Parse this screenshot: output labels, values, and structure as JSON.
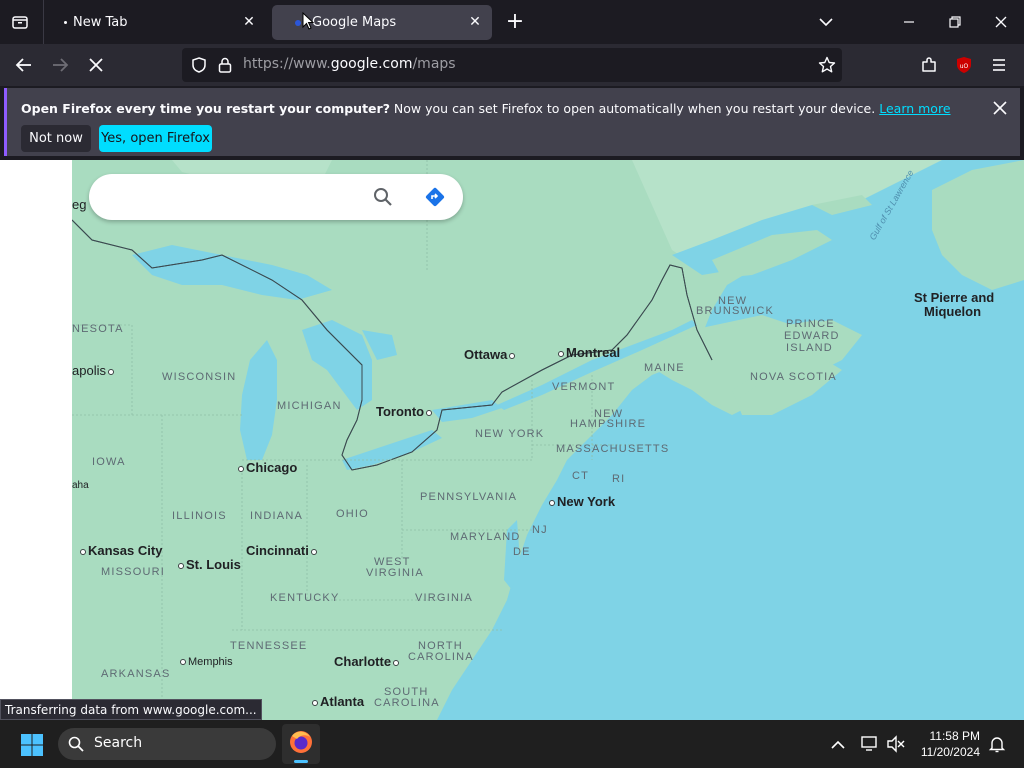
{
  "browser": {
    "tabs": [
      {
        "label": "New Tab",
        "active": false
      },
      {
        "label": "Google Maps",
        "active": true
      }
    ],
    "url": {
      "prefix": "https://www.",
      "domain": "google.com",
      "path": "/maps"
    },
    "status_text": "Transferring data from www.google.com..."
  },
  "notification": {
    "title": "Open Firefox every time you restart your computer?",
    "message": " Now you can set Firefox to open automatically when you restart your device.",
    "link": "Learn more",
    "not_now": "Not now",
    "yes": "Yes, open Firefox"
  },
  "map": {
    "labels": {
      "gulf": "Gulf of St Lawrence",
      "st_pierre_1": "St Pierre and",
      "st_pierre_2": "Miquelon",
      "new_brunswick_1": "NEW",
      "new_brunswick_2": "BRUNSWICK",
      "pei_1": "PRINCE",
      "pei_2": "EDWARD",
      "pei_3": "ISLAND",
      "nova_scotia": "NOVA SCOTIA",
      "maine": "MAINE",
      "vermont": "VERMONT",
      "nh_1": "NEW",
      "nh_2": "HAMPSHIRE",
      "massachusetts": "MASSACHUSETTS",
      "ct": "CT",
      "ri": "RI",
      "new_york_state": "NEW YORK",
      "new_york_city": "New York",
      "nj": "NJ",
      "de": "DE",
      "maryland": "MARYLAND",
      "pennsylvania": "PENNSYLVANIA",
      "ottawa": "Ottawa",
      "montreal": "Montreal",
      "toronto": "Toronto",
      "michigan": "MICHIGAN",
      "wisconsin": "WISCONSIN",
      "minnesota": "NESOTA",
      "minneapolis": "apolis",
      "iowa": "IOWA",
      "omaha": "aha",
      "chicago": "Chicago",
      "illinois": "ILLINOIS",
      "indiana": "INDIANA",
      "ohio": "OHIO",
      "kansas_city": "Kansas City",
      "missouri": "MISSOURI",
      "st_louis": "St. Louis",
      "cincinnati": "Cincinnati",
      "west_virginia_1": "WEST",
      "west_virginia_2": "VIRGINIA",
      "virginia": "VIRGINIA",
      "kentucky": "KENTUCKY",
      "tennessee": "TENNESSEE",
      "memphis": "Memphis",
      "arkansas": "ARKANSAS",
      "charlotte": "Charlotte",
      "north_carolina_1": "NORTH",
      "north_carolina_2": "CAROLINA",
      "south_carolina_1": "SOUTH",
      "south_carolina_2": "CAROLINA",
      "atlanta": "Atlanta",
      "reg": "eg"
    }
  },
  "taskbar": {
    "search_placeholder": "Search",
    "time": "11:58 PM",
    "date": "11/20/2024"
  },
  "colors": {
    "water": "#7fd3e6",
    "land": "#a9dcc0",
    "accent": "#00ddff"
  }
}
